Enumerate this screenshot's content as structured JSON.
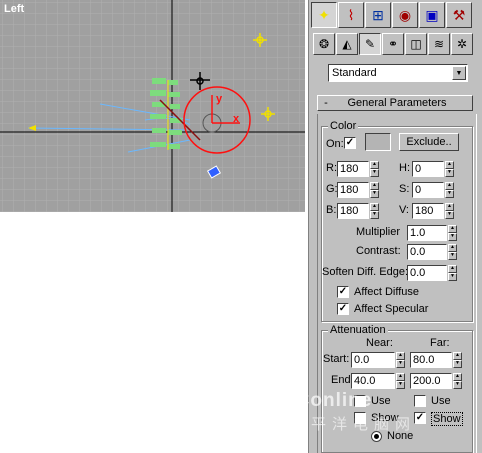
{
  "viewport": {
    "label": "Left",
    "axis_x": "x",
    "axis_y": "y",
    "background": "#a0a0a0"
  },
  "tabs": {
    "main": [
      {
        "icon": "create-icon"
      },
      {
        "icon": "modify-icon"
      },
      {
        "icon": "hierarchy-icon"
      },
      {
        "icon": "motion-icon"
      },
      {
        "icon": "display-icon"
      },
      {
        "icon": "utilities-icon"
      }
    ],
    "sub": [
      {
        "icon": "geometry-icon"
      },
      {
        "icon": "shapes-icon"
      },
      {
        "icon": "lights-icon"
      },
      {
        "icon": "cameras-icon"
      },
      {
        "icon": "helpers-icon"
      },
      {
        "icon": "space-warps-icon"
      },
      {
        "icon": "systems-icon"
      }
    ]
  },
  "category_dropdown": {
    "value": "Standard"
  },
  "general_parameters": {
    "rollout_symbol": "-",
    "title": "General Parameters",
    "color_group": {
      "title": "Color",
      "on_label": "On:",
      "on_checked": true,
      "exclude_label": "Exclude..",
      "swatch_color": "#b4b4b4",
      "r_label": "R:",
      "r_value": "180",
      "g_label": "G:",
      "g_value": "180",
      "b_label": "B:",
      "b_value": "180",
      "h_label": "H:",
      "h_value": "0",
      "s_label": "S:",
      "s_value": "0",
      "v_label": "V:",
      "v_value": "180",
      "multiplier_label": "Multiplier",
      "multiplier_value": "1.0",
      "contrast_label": "Contrast:",
      "contrast_value": "0.0",
      "soften_label": "Soften Diff. Edge:",
      "soften_value": "0.0",
      "affect_diffuse_label": "Affect Diffuse",
      "affect_diffuse_checked": true,
      "affect_specular_label": "Affect Specular",
      "affect_specular_checked": true
    },
    "attenuation_group": {
      "title": "Attenuation",
      "near_label": "Near:",
      "far_label": "Far:",
      "start_label": "Start:",
      "near_start": "0.0",
      "far_start": "80.0",
      "end_label": "End:",
      "near_end": "40.0",
      "far_end": "200.0",
      "near_use_label": "Use",
      "near_use_checked": false,
      "far_use_label": "Use",
      "far_use_checked": false,
      "near_show_label": "Show",
      "near_show_checked": false,
      "far_show_label": "Show",
      "far_show_checked": true,
      "none_label": "None",
      "none_selected": true
    }
  },
  "watermark": {
    "text": "PConline",
    "text2": "太平洋电脑网"
  }
}
